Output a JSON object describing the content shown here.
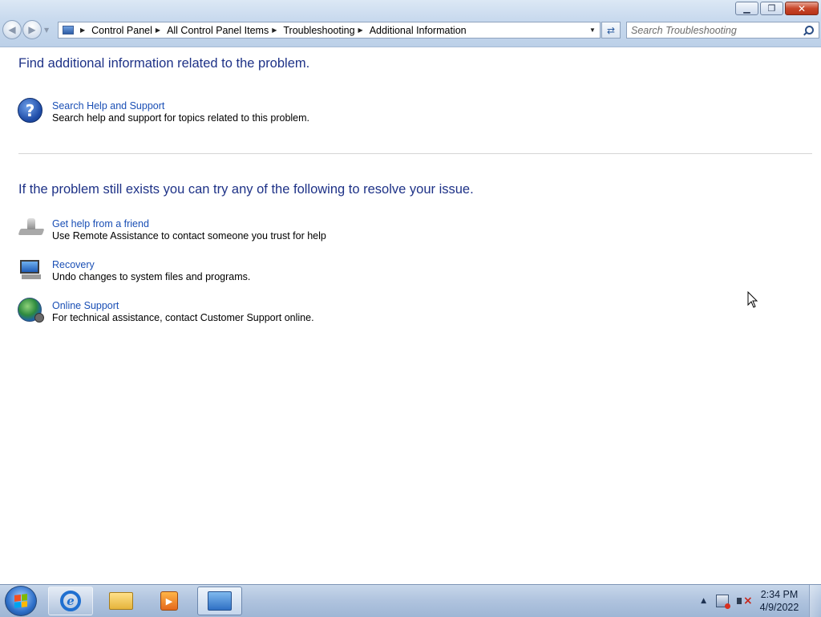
{
  "window": {
    "minimize_glyph": "▁",
    "restore_glyph": "❐",
    "close_glyph": "✕"
  },
  "nav": {
    "back_glyph": "◀",
    "forward_glyph": "▶"
  },
  "address": {
    "breadcrumbs": [
      "Control Panel",
      "All Control Panel Items",
      "Troubleshooting",
      "Additional Information"
    ],
    "separator": "▶",
    "dropdown_glyph": "▼",
    "refresh_glyph": "⇄"
  },
  "search": {
    "placeholder": "Search Troubleshooting"
  },
  "section1": {
    "heading": "Find additional information related to the problem.",
    "items": [
      {
        "icon": "help-icon",
        "title": "Search Help and Support",
        "description": "Search help and support for topics related to this problem."
      }
    ]
  },
  "section2": {
    "heading": "If the problem still exists you can try any of the following to resolve your issue.",
    "items": [
      {
        "icon": "remote-assistance-icon",
        "title": "Get help from a friend",
        "description": "Use Remote Assistance to contact someone you trust for help"
      },
      {
        "icon": "recovery-icon",
        "title": "Recovery",
        "description": "Undo changes to system files and programs."
      },
      {
        "icon": "online-support-icon",
        "title": "Online Support",
        "description": "For technical assistance, contact Customer Support online."
      }
    ]
  },
  "taskbar": {
    "media_glyph": "▶",
    "tray_arrow": "▲",
    "time": "2:34 PM",
    "date": "4/9/2022",
    "ie_glyph": "e"
  }
}
